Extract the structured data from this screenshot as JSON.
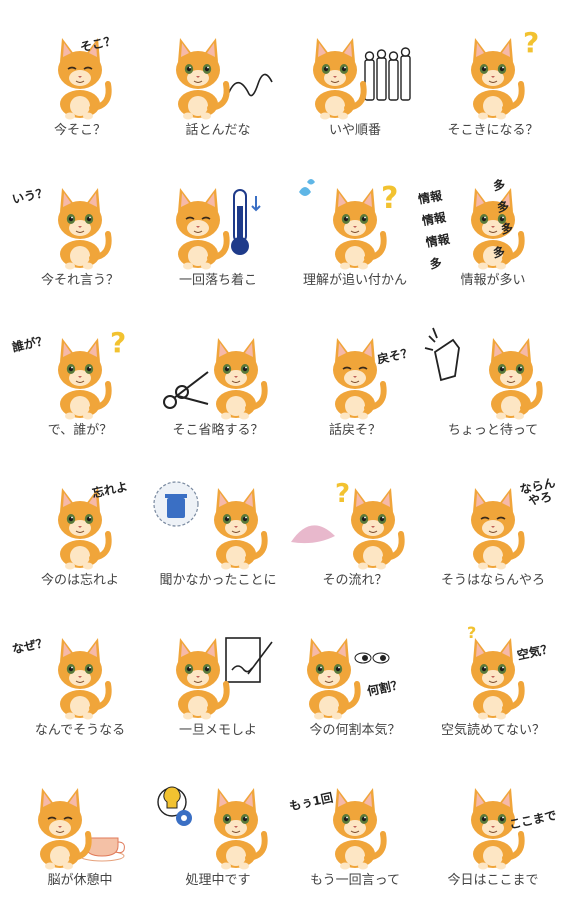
{
  "colors": {
    "cat_main": "#f0a53a",
    "cat_dark": "#d9822b",
    "cat_belly": "#fde6c4",
    "ear_inner": "#f6b9a8",
    "text": "#444444",
    "accent_yellow": "#f2c230",
    "accent_blue": "#3a6fc4"
  },
  "stickers": [
    {
      "caption": "今そこ？",
      "bubble": "そこ？",
      "prop": "none"
    },
    {
      "caption": "話とんだな",
      "bubble": "",
      "prop": "swirl"
    },
    {
      "caption": "いや順番",
      "bubble": "",
      "prop": "queue-icon"
    },
    {
      "caption": "そこきになる？",
      "bubble": "？？",
      "prop": "question-yellow"
    },
    {
      "caption": "今それ言う？",
      "bubble": "いう？",
      "prop": "none"
    },
    {
      "caption": "一回落ち着こ",
      "bubble": "",
      "prop": "thermometer-icon"
    },
    {
      "caption": "理解が追い付かん",
      "bubble": "？",
      "prop": "sweat-question"
    },
    {
      "caption": "情報が多い",
      "bubble": "情報 多 情報 多 情報 多 多 多",
      "prop": "text-pile"
    },
    {
      "caption": "で、誰が？",
      "bubble": "誰が？",
      "prop": "question-yellow"
    },
    {
      "caption": "そこ省略する？",
      "bubble": "",
      "prop": "scissors-icon"
    },
    {
      "caption": "話戻そ？",
      "bubble": "戻そ？",
      "prop": "none"
    },
    {
      "caption": "ちょっと待って",
      "bubble": "",
      "prop": "hand-icon"
    },
    {
      "caption": "今のは忘れよ",
      "bubble": "忘れよ",
      "prop": "none"
    },
    {
      "caption": "聞かなかったことに",
      "bubble": "",
      "prop": "trash-icon"
    },
    {
      "caption": "その流れ？",
      "bubble": "？",
      "prop": "splash"
    },
    {
      "caption": "そうはならんやろ",
      "bubble": "ならん やろ",
      "prop": "none"
    },
    {
      "caption": "なんでそうなる",
      "bubble": "なぜ？",
      "prop": "none"
    },
    {
      "caption": "一旦メモしよ",
      "bubble": "",
      "prop": "memo-icon"
    },
    {
      "caption": "今の何割本気？",
      "bubble": "何割？",
      "prop": "eyes"
    },
    {
      "caption": "空気読めてない？",
      "bubble": "空気？",
      "prop": "question-small"
    },
    {
      "caption": "脳が休憩中",
      "bubble": "",
      "prop": "teacup-icon"
    },
    {
      "caption": "処理中です",
      "bubble": "",
      "prop": "gear-bulb-icon"
    },
    {
      "caption": "もう一回言って",
      "bubble": "もぅ1回",
      "prop": "none"
    },
    {
      "caption": "今日はここまで",
      "bubble": "ここまで",
      "prop": "none"
    }
  ]
}
